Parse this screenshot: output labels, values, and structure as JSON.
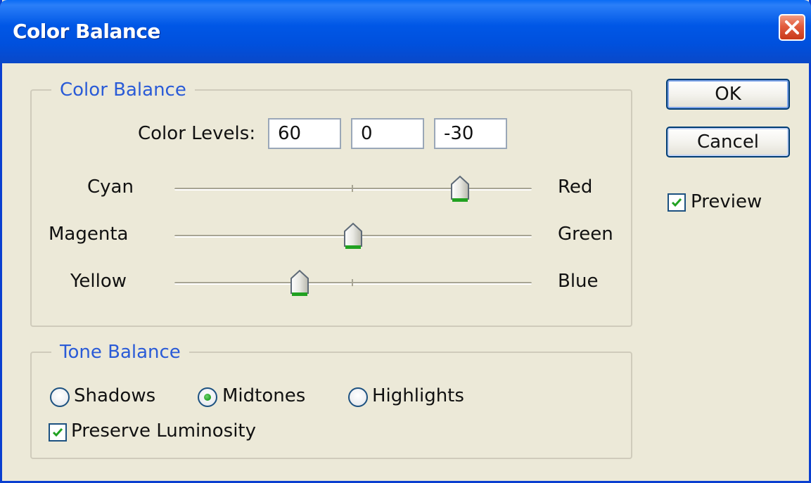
{
  "window": {
    "title": "Color Balance",
    "close_icon": "close-icon"
  },
  "color_balance_group": {
    "legend": "Color Balance",
    "levels_label": "Color Levels:",
    "levels": [
      "60",
      "0",
      "-30"
    ],
    "sliders": [
      {
        "left_label": "Cyan",
        "right_label": "Red",
        "value": 60,
        "min": -100,
        "max": 100
      },
      {
        "left_label": "Magenta",
        "right_label": "Green",
        "value": 0,
        "min": -100,
        "max": 100
      },
      {
        "left_label": "Yellow",
        "right_label": "Blue",
        "value": -30,
        "min": -100,
        "max": 100
      }
    ]
  },
  "tone_balance_group": {
    "legend": "Tone Balance",
    "options": [
      {
        "label": "Shadows",
        "selected": false
      },
      {
        "label": "Midtones",
        "selected": true
      },
      {
        "label": "Highlights",
        "selected": false
      }
    ],
    "preserve_luminosity": {
      "label": "Preserve Luminosity",
      "checked": true
    }
  },
  "buttons": {
    "ok_label": "OK",
    "cancel_label": "Cancel"
  },
  "preview": {
    "label": "Preview",
    "checked": true
  },
  "colors": {
    "titlebar": "#0054e3",
    "legend_text": "#2a5bd7",
    "check_green": "#21a121"
  }
}
